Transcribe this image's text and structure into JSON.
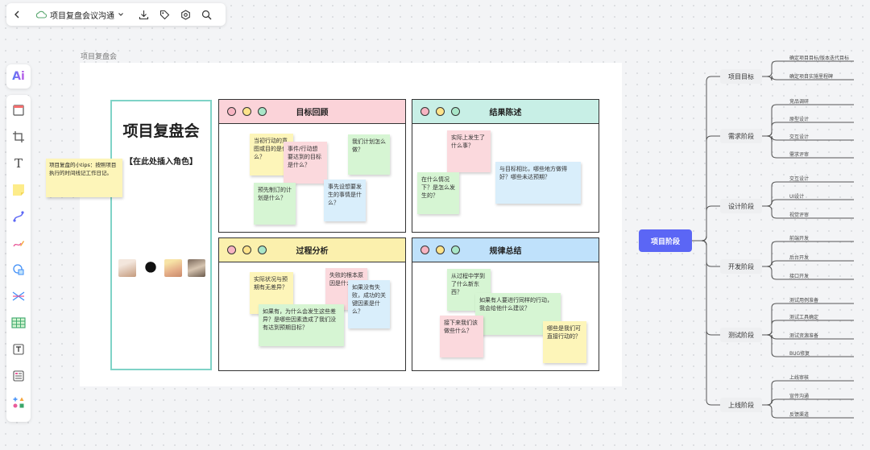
{
  "toolbar": {
    "doc_title": "项目复盘会议沟通",
    "icons": [
      "back-icon",
      "cloud-icon",
      "chevron-down-icon",
      "download-icon",
      "tag-icon",
      "settings-icon",
      "search-icon"
    ]
  },
  "left_tools": {
    "ai_label": "Ai",
    "items": [
      "frame-tool-icon",
      "crop-tool-icon",
      "text-tool-icon",
      "sticky-note-tool-icon",
      "connector-tool-icon",
      "pen-tool-icon",
      "shape-tool-icon",
      "mindmap-tool-icon",
      "table-tool-icon",
      "text-card-tool-icon",
      "list-tool-icon",
      "more-tools-icon"
    ],
    "text_tool_glyph": "T"
  },
  "frame": {
    "label": "项目复盘会",
    "title": "项目复盘会",
    "role_placeholder": "【在此处插入角色】",
    "tip": "项目复盘的小tips：按照项目执行的时间线记工作日记。"
  },
  "quadrants": {
    "goals": {
      "title": "目标回顾",
      "header_color": "#fbd3d9",
      "notes": [
        "当初行动的意图或目的是什么？",
        "事件/行动想要达到的目标是什么？",
        "我们计划怎么做？",
        "预先制订的计划是什么？",
        "事先设想要发生的事情是什么？"
      ]
    },
    "results": {
      "title": "结果陈述",
      "header_color": "#c8efe6",
      "notes": [
        "实际上发生了什么事？",
        "在什么情况下？是怎么发生的？",
        "与目标相比，哪些地方做得好？哪些未达预期？"
      ]
    },
    "process": {
      "title": "过程分析",
      "header_color": "#fbf0ad",
      "notes": [
        "实际状况与预期有无差异？",
        "失败的根本原因是什么？",
        "如果没有失败，成功的关键因素是什么？",
        "如果有，为什么会发生这些差异？是哪些因素造成了我们没有达到预期目标？"
      ]
    },
    "patterns": {
      "title": "规律总结",
      "header_color": "#bfe1fb",
      "notes": [
        "从过程中学到了什么新东西？",
        "如果有人要进行同样的行动，我会给他什么建议？",
        "接下来我们该做些什么？",
        "哪些是我们可直接行动的？"
      ]
    }
  },
  "mindmap": {
    "root": "项目阶段",
    "branches": [
      {
        "label": "项目目标",
        "children": [
          "确定项目目标/版本迭代目标",
          "确定项目实施里程碑"
        ]
      },
      {
        "label": "需求阶段",
        "children": [
          "竞品调研",
          "原型设计",
          "交互设计",
          "需求评审"
        ]
      },
      {
        "label": "设计阶段",
        "children": [
          "交互设计",
          "UI设计",
          "视觉评审"
        ]
      },
      {
        "label": "开发阶段",
        "children": [
          "前端开发",
          "后台开发",
          "接口开发"
        ]
      },
      {
        "label": "测试阶段",
        "children": [
          "测试用例准备",
          "测试工具确定",
          "测试资源准备",
          "BUG修复"
        ]
      },
      {
        "label": "上线阶段",
        "children": [
          "上线审核",
          "宣传沟通",
          "反馈渠道"
        ]
      }
    ]
  },
  "colors": {
    "accent": "#5b66f5",
    "title_card_border": "#7fd3c7",
    "sticky_yellow": "#fdf5b9",
    "sticky_green": "#d6f5d3",
    "sticky_pink": "#fbd9dd",
    "sticky_blue": "#d9eefb"
  }
}
